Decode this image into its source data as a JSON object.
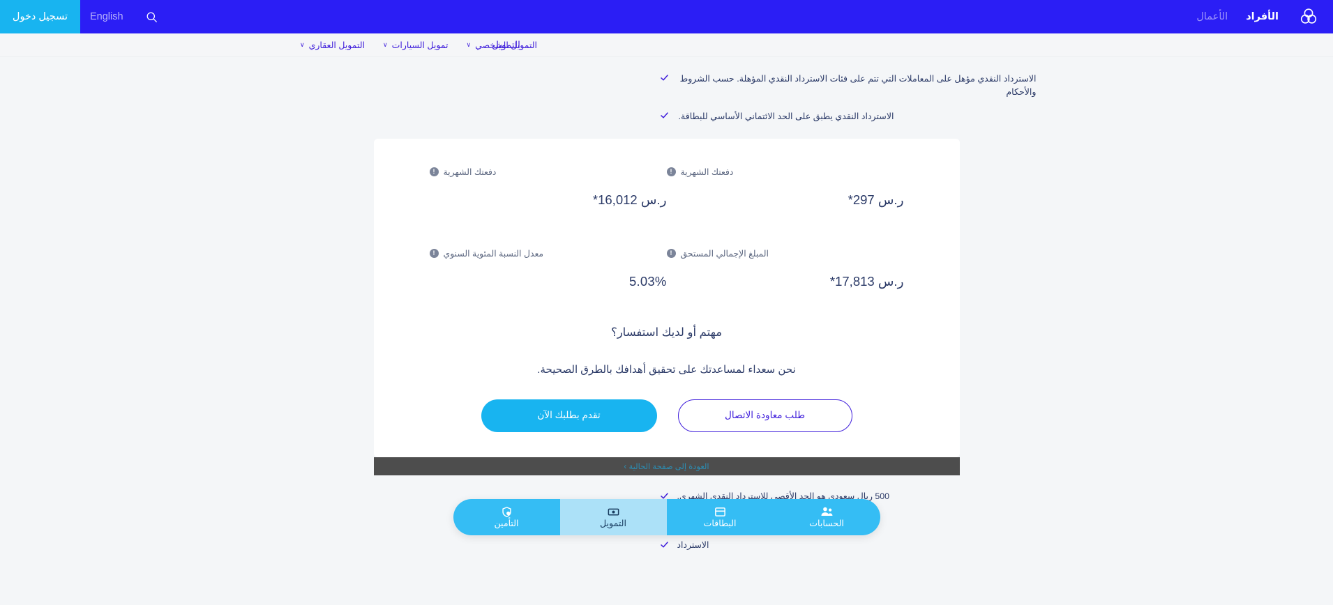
{
  "colors": {
    "nav_blue": "#2B1EF5",
    "cyan": "#18B4F0",
    "link_blue": "#3F1EDB",
    "text_navy": "#2B3A67",
    "page_bg": "#f4f6f8",
    "dark_bar": "#4d4d4d",
    "bottomnav_bg": "#35BDF4",
    "bottomnav_active_bg": "#ACE1F8"
  },
  "topbar": {
    "logo_name": "bank-logo-icon",
    "audience": [
      {
        "label": "الأفراد",
        "active": true
      },
      {
        "label": "الأعمال",
        "active": false
      }
    ],
    "search_icon": "search-icon",
    "language_label": "English",
    "login_label": "تسجيل دخول"
  },
  "subnav": {
    "title": "التمويل",
    "items": [
      {
        "label": "التمويل الشخصي",
        "caret": "∨"
      },
      {
        "label": "تمويل السيارات",
        "caret": "∨"
      },
      {
        "label": "التمويل العقاري",
        "caret": "∨"
      }
    ]
  },
  "checklist_top": [
    {
      "icon": "check-icon",
      "text": "الاسترداد النقدي مؤهل على المعاملات التي تتم على فئات الاسترداد النقدي المؤهلة. حسب الشروط والأحكام"
    },
    {
      "icon": "check-icon",
      "text": "الاسترداد النقدي يطبق على الحد الائتماني الأساسي للبطاقة."
    }
  ],
  "card": {
    "figures": [
      {
        "label": "دفعتك الشهرية",
        "value": "ر.س 297*",
        "info_icon": "info-icon"
      },
      {
        "label": "دفعتك الشهرية",
        "value": "ر.س 16,012*",
        "info_icon": "info-icon"
      },
      {
        "label": "المبلغ الإجمالي المستحق",
        "value": "ر.س 17,813*",
        "info_icon": "info-icon"
      },
      {
        "label": "معدل النسبة المئوية السنوي",
        "value": "5.03%",
        "info_icon": "info-icon"
      }
    ],
    "cta": {
      "heading": "مهتم أو لديك استفسار؟",
      "subheading": "نحن سعداء لمساعدتك على تحقيق أهدافك بالطرق الصحيحة.",
      "primary_label": "تقدم بطلبك الآن",
      "outline_label": "طلب معاودة الاتصال"
    }
  },
  "dark_bar": {
    "link_label": "العودة إلى صفحة الحالية ›"
  },
  "checklist_bottom": [
    {
      "icon": "check-icon",
      "text": "500 ريال سعودي هو الحد الأقصى للاسترداد النقدي الشهري."
    },
    {
      "icon": "check-icon",
      "text": "الاسترداد"
    },
    {
      "icon": "check-icon",
      "text": "الاسترداد"
    }
  ],
  "bottom_nav": [
    {
      "label": "الحسابات",
      "icon": "people-accounts-icon",
      "active": false
    },
    {
      "label": "البطاقات",
      "icon": "credit-card-icon",
      "active": false
    },
    {
      "label": "التمويل",
      "icon": "banknote-icon",
      "active": true
    },
    {
      "label": "التأمين",
      "icon": "shield-person-icon",
      "active": false
    }
  ]
}
